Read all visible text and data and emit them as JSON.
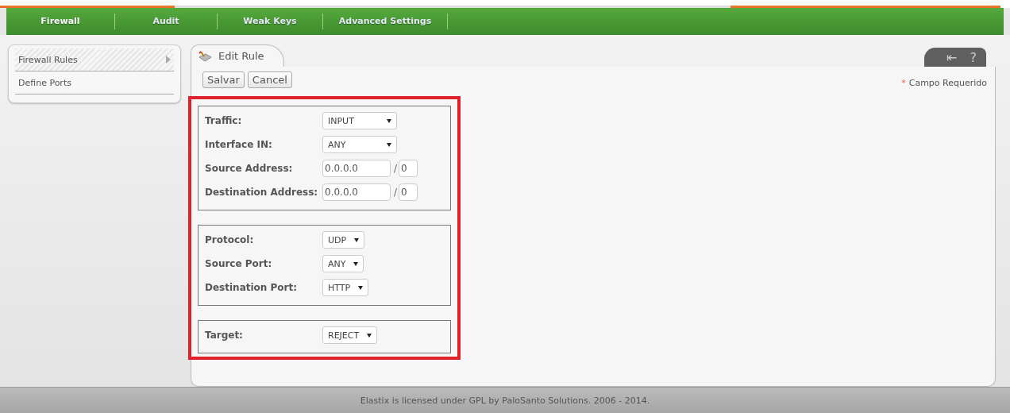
{
  "nav": [
    {
      "label": "Firewall",
      "selected": true
    },
    {
      "label": "Audit",
      "selected": false
    },
    {
      "label": "Weak Keys",
      "selected": false
    },
    {
      "label": "Advanced Settings",
      "selected": false
    }
  ],
  "sidebar": {
    "items": [
      {
        "label": "Firewall Rules",
        "selected": true
      },
      {
        "label": "Define Ports",
        "selected": false
      }
    ]
  },
  "panel": {
    "tab": "Edit Rule",
    "tools": {
      "collapse": "⇤",
      "help": "?"
    },
    "buttons": [
      "Salvar",
      "Cancel"
    ],
    "required_mark": "*",
    "required_note": "Campo Requerido",
    "sections": [
      {
        "fields": [
          {
            "label": "Traffic:",
            "kind": "select",
            "value": "INPUT"
          },
          {
            "label": "Interface IN:",
            "kind": "select",
            "value": "ANY"
          },
          {
            "label": "Source Address:",
            "kind": "address",
            "value": "0.0.0.0",
            "separator": "/",
            "mask": "0"
          },
          {
            "label": "Destination Address:",
            "kind": "address",
            "value": "0.0.0.0",
            "separator": "/",
            "mask": "0"
          }
        ]
      },
      {
        "fields": [
          {
            "label": "Protocol:",
            "kind": "select",
            "value": "UDP"
          },
          {
            "label": "Source Port:",
            "kind": "select",
            "value": "ANY"
          },
          {
            "label": "Destination Port:",
            "kind": "select",
            "value": "HTTP"
          }
        ]
      },
      {
        "fields": [
          {
            "label": "Target:",
            "kind": "select",
            "value": "REJECT"
          }
        ]
      }
    ]
  },
  "footer": "Elastix is licensed under GPL by PaloSanto Solutions. 2006 - 2014."
}
